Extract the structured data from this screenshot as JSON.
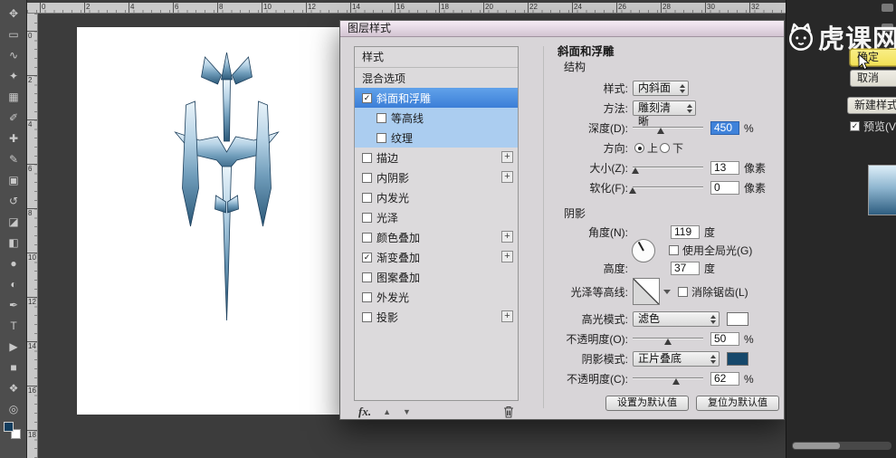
{
  "app": {
    "watermark": "虎课网"
  },
  "colors": {
    "selection_blue": "#3e82d8",
    "sub_item_blue": "#abcdf0",
    "highlight_yellow": "#f6e96d",
    "highlight_swatch": "#ffffff",
    "shadow_swatch": "#16486b"
  },
  "toolbar": {
    "tools": [
      {
        "name": "move-tool",
        "glyph": "✥"
      },
      {
        "name": "marquee-tool",
        "glyph": "▭"
      },
      {
        "name": "lasso-tool",
        "glyph": "∿"
      },
      {
        "name": "quick-selection-tool",
        "glyph": "✦"
      },
      {
        "name": "crop-tool",
        "glyph": "▦"
      },
      {
        "name": "eyedropper-tool",
        "glyph": "✐"
      },
      {
        "name": "healing-brush-tool",
        "glyph": "✚"
      },
      {
        "name": "brush-tool",
        "glyph": "✎"
      },
      {
        "name": "clone-stamp-tool",
        "glyph": "▣"
      },
      {
        "name": "history-brush-tool",
        "glyph": "↺"
      },
      {
        "name": "eraser-tool",
        "glyph": "◪"
      },
      {
        "name": "gradient-tool",
        "glyph": "◧"
      },
      {
        "name": "blur-tool",
        "glyph": "●"
      },
      {
        "name": "dodge-tool",
        "glyph": "◐"
      },
      {
        "name": "pen-tool",
        "glyph": "✒"
      },
      {
        "name": "type-tool",
        "glyph": "T"
      },
      {
        "name": "path-selection-tool",
        "glyph": "▶"
      },
      {
        "name": "shape-tool",
        "glyph": "■"
      },
      {
        "name": "hand-tool",
        "glyph": "❖"
      },
      {
        "name": "zoom-tool",
        "glyph": "◎"
      }
    ]
  },
  "rulers": {
    "horizontal": [
      "0",
      "2",
      "4",
      "6",
      "8",
      "10",
      "12",
      "14",
      "16",
      "18",
      "20",
      "22",
      "24",
      "26",
      "28",
      "30",
      "32"
    ],
    "vertical": [
      "0",
      "2",
      "4",
      "6",
      "8",
      "10",
      "12",
      "14",
      "16",
      "18"
    ]
  },
  "canvas": {
    "artwork": "trident-logo"
  },
  "dialog": {
    "title": "图层样式",
    "styles_panel": {
      "header": "样式",
      "items": [
        {
          "label": "混合选项",
          "has_checkbox": false,
          "checked": false,
          "selected": false,
          "sub": false,
          "plus": false
        },
        {
          "label": "斜面和浮雕",
          "has_checkbox": true,
          "checked": true,
          "selected": true,
          "sub": false,
          "plus": false
        },
        {
          "label": "等高线",
          "has_checkbox": true,
          "checked": false,
          "selected": false,
          "sub": true,
          "plus": false
        },
        {
          "label": "纹理",
          "has_checkbox": true,
          "checked": false,
          "selected": false,
          "sub": true,
          "plus": false
        },
        {
          "label": "描边",
          "has_checkbox": true,
          "checked": false,
          "selected": false,
          "sub": false,
          "plus": true
        },
        {
          "label": "内阴影",
          "has_checkbox": true,
          "checked": false,
          "selected": false,
          "sub": false,
          "plus": true
        },
        {
          "label": "内发光",
          "has_checkbox": true,
          "checked": false,
          "selected": false,
          "sub": false,
          "plus": false
        },
        {
          "label": "光泽",
          "has_checkbox": true,
          "checked": false,
          "selected": false,
          "sub": false,
          "plus": false
        },
        {
          "label": "颜色叠加",
          "has_checkbox": true,
          "checked": false,
          "selected": false,
          "sub": false,
          "plus": true
        },
        {
          "label": "渐变叠加",
          "has_checkbox": true,
          "checked": true,
          "selected": false,
          "sub": false,
          "plus": true
        },
        {
          "label": "图案叠加",
          "has_checkbox": true,
          "checked": false,
          "selected": false,
          "sub": false,
          "plus": false
        },
        {
          "label": "外发光",
          "has_checkbox": true,
          "checked": false,
          "selected": false,
          "sub": false,
          "plus": false
        },
        {
          "label": "投影",
          "has_checkbox": true,
          "checked": false,
          "selected": false,
          "sub": false,
          "plus": true
        }
      ]
    },
    "fx_bar": {
      "fx_label": "fx."
    },
    "settings": {
      "title": "斜面和浮雕",
      "structure_label": "结构",
      "style_label": "样式:",
      "style_value": "内斜面",
      "method_label": "方法:",
      "method_value": "雕刻清晰",
      "depth_label": "深度(D):",
      "depth_value": "450",
      "depth_unit": "%",
      "direction_label": "方向:",
      "direction_up_label": "上",
      "direction_down_label": "下",
      "direction_value": "上",
      "size_label": "大小(Z):",
      "size_value": "13",
      "size_unit": "像素",
      "soften_label": "软化(F):",
      "soften_value": "0",
      "soften_unit": "像素",
      "shading_label": "阴影",
      "angle_label": "角度(N):",
      "angle_value": "119",
      "angle_unit": "度",
      "global_light_label": "使用全局光(G)",
      "global_light_checked": false,
      "altitude_label": "高度:",
      "altitude_value": "37",
      "altitude_unit": "度",
      "gloss_contour_label": "光泽等高线:",
      "antialias_label": "消除锯齿(L)",
      "antialias_checked": false,
      "highlight_mode_label": "高光模式:",
      "highlight_mode_value": "滤色",
      "highlight_opacity_label": "不透明度(O):",
      "highlight_opacity_value": "50",
      "highlight_opacity_unit": "%",
      "shadow_mode_label": "阴影模式:",
      "shadow_mode_value": "正片叠底",
      "shadow_opacity_label": "不透明度(C):",
      "shadow_opacity_value": "62",
      "shadow_opacity_unit": "%",
      "set_default_label": "设置为默认值",
      "reset_default_label": "复位为默认值",
      "sliders": {
        "depth": 40,
        "size": 4,
        "soften": 0,
        "highlight_opacity": 50,
        "shadow_opacity": 62
      }
    }
  },
  "right_panel": {
    "ok_label": "确定",
    "cancel_label": "取消",
    "new_style_label": "新建样式(W)...",
    "preview_label": "预览(V)",
    "preview_checked": true
  }
}
